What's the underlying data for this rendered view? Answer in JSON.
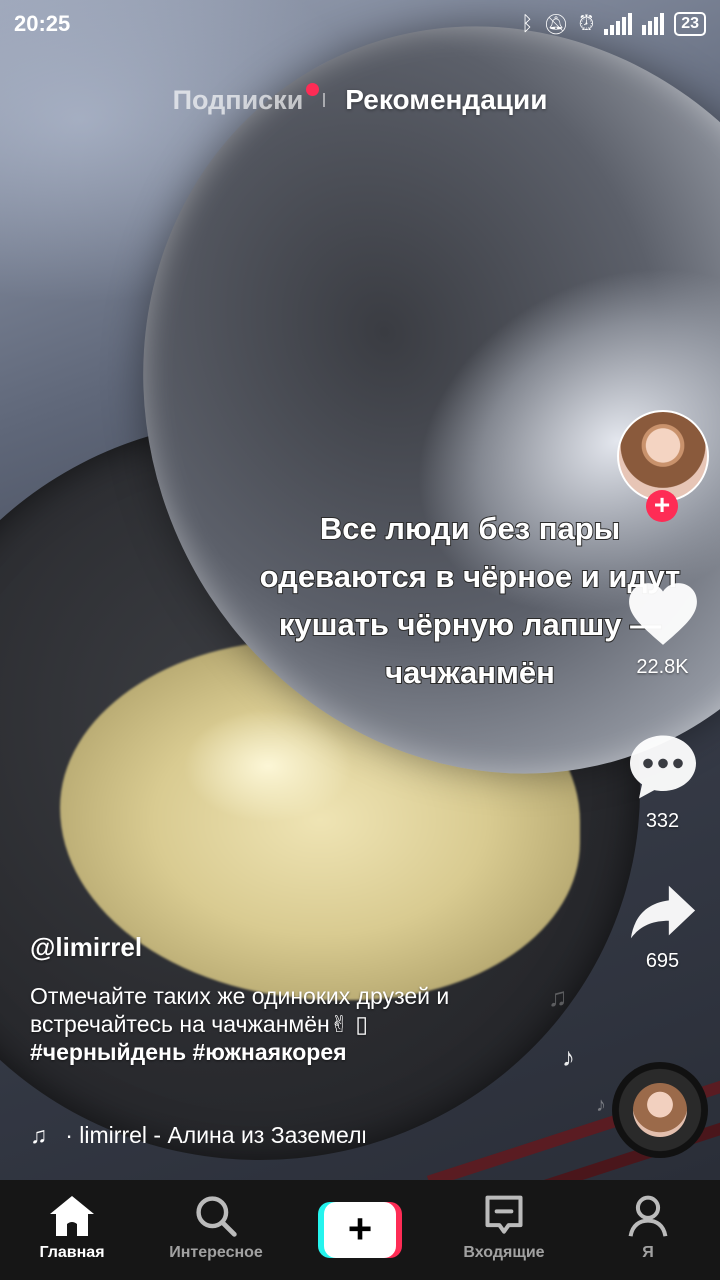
{
  "status_bar": {
    "time": "20:25",
    "battery": "23"
  },
  "top_tabs": {
    "following": "Подписки",
    "for_you": "Рекомендации"
  },
  "video_caption": "Все люди без пары одеваются в чёрное и идут кушать чёрную лапшу — чачжанмён",
  "actions": {
    "likes": "22.8K",
    "comments": "332",
    "shares": "695"
  },
  "post": {
    "author": "@limirrel",
    "description": "Отмечайте таких же одиноких друзей и встречайтесь на чачжанмён✌",
    "hashtag_1": "#черныйдень",
    "hashtag_2": "#южнаякорея",
    "music": "· limirrel - Алина из Заземелья"
  },
  "bottom_nav": {
    "home": "Главная",
    "discover": "Интересное",
    "create": "+",
    "inbox": "Входящие",
    "profile": "Я"
  },
  "colors": {
    "accent": "#fe2c55",
    "cyan": "#25f4ee"
  }
}
